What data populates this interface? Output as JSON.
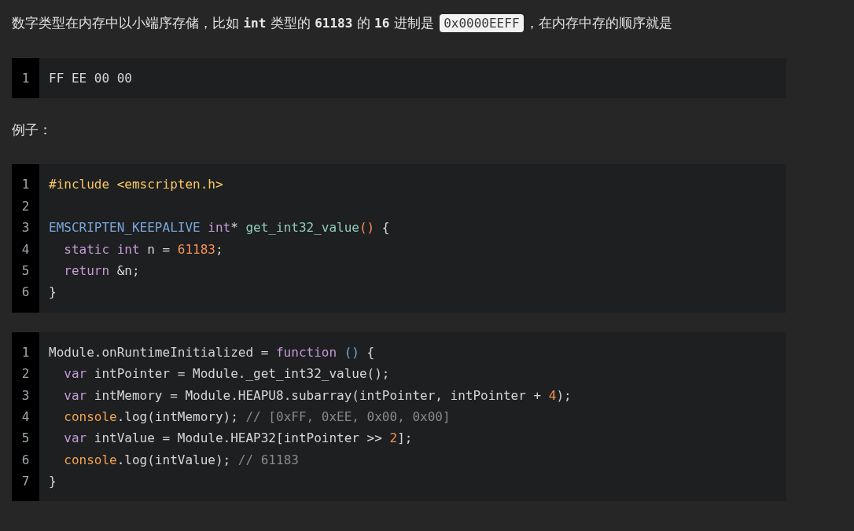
{
  "content": [
    {
      "kind": "paragraph",
      "segments": [
        {
          "kind": "text",
          "text": "数字类型在内存中以小端序存储，比如 "
        },
        {
          "kind": "code",
          "text": "int"
        },
        {
          "kind": "text",
          "text": " 类型的 "
        },
        {
          "kind": "code",
          "text": "61183"
        },
        {
          "kind": "text",
          "text": " 的 "
        },
        {
          "kind": "code",
          "text": "16"
        },
        {
          "kind": "text",
          "text": " 进制是 "
        },
        {
          "kind": "chip",
          "text": "0x0000EEFF"
        },
        {
          "kind": "text",
          "text": "，在内存中存的顺序就是"
        }
      ]
    },
    {
      "kind": "codeblock",
      "lines": [
        {
          "number": "1",
          "tokens": [
            {
              "kind": "plain",
              "text": "FF EE 00 00"
            }
          ]
        }
      ]
    },
    {
      "kind": "paragraph",
      "segments": [
        {
          "kind": "text",
          "text": "例子："
        }
      ]
    },
    {
      "kind": "codeblock",
      "lines": [
        {
          "number": "1",
          "tokens": [
            {
              "kind": "meta",
              "text": "#include <emscripten.h>"
            }
          ]
        },
        {
          "number": "2"
        },
        {
          "number": "3",
          "tokens": [
            {
              "kind": "type",
              "text": "EMSCRIPTEN_KEEPALIVE "
            },
            {
              "kind": "keyword",
              "text": "int"
            },
            {
              "kind": "plain",
              "text": "* "
            },
            {
              "kind": "function",
              "text": "get_int32_value"
            },
            {
              "kind": "number",
              "text": "()"
            },
            {
              "kind": "plain",
              "text": " {"
            }
          ]
        },
        {
          "number": "4",
          "tokens": [
            {
              "kind": "keyword",
              "text": "  static int"
            },
            {
              "kind": "plain",
              "text": " n = "
            },
            {
              "kind": "number",
              "text": "61183"
            },
            {
              "kind": "plain",
              "text": ";"
            }
          ]
        },
        {
          "number": "5",
          "tokens": [
            {
              "kind": "keyword",
              "text": "  return"
            },
            {
              "kind": "plain",
              "text": " &n;"
            }
          ]
        },
        {
          "number": "6",
          "tokens": [
            {
              "kind": "plain",
              "text": "}"
            }
          ]
        }
      ]
    },
    {
      "kind": "codeblock",
      "lines": [
        {
          "number": "1",
          "tokens": [
            {
              "kind": "plain",
              "text": "Module.onRuntimeInitialized = "
            },
            {
              "kind": "keyword",
              "text": "function "
            },
            {
              "kind": "type",
              "text": "()"
            },
            {
              "kind": "plain",
              "text": " {"
            }
          ]
        },
        {
          "number": "2",
          "tokens": [
            {
              "kind": "keyword",
              "text": "  var"
            },
            {
              "kind": "plain",
              "text": " intPointer = Module._get_int32_value();"
            }
          ]
        },
        {
          "number": "3",
          "tokens": [
            {
              "kind": "keyword",
              "text": "  var"
            },
            {
              "kind": "plain",
              "text": " intMemory = Module.HEAPU8.subarray(intPointer, intPointer + "
            },
            {
              "kind": "number",
              "text": "4"
            },
            {
              "kind": "plain",
              "text": ");"
            }
          ]
        },
        {
          "number": "4",
          "tokens": [
            {
              "kind": "builtin",
              "text": "  console"
            },
            {
              "kind": "plain",
              "text": ".log(intMemory); "
            },
            {
              "kind": "comment",
              "text": "// [0xFF, 0xEE, 0x00, 0x00]"
            }
          ]
        },
        {
          "number": "5",
          "tokens": [
            {
              "kind": "keyword",
              "text": "  var"
            },
            {
              "kind": "plain",
              "text": " intValue = Module.HEAP32[intPointer >> "
            },
            {
              "kind": "number",
              "text": "2"
            },
            {
              "kind": "plain",
              "text": "];"
            }
          ]
        },
        {
          "number": "6",
          "tokens": [
            {
              "kind": "builtin",
              "text": "  console"
            },
            {
              "kind": "plain",
              "text": ".log(intValue); "
            },
            {
              "kind": "comment",
              "text": "// 61183"
            }
          ]
        },
        {
          "number": "7",
          "tokens": [
            {
              "kind": "plain",
              "text": "}"
            }
          ]
        }
      ]
    }
  ]
}
